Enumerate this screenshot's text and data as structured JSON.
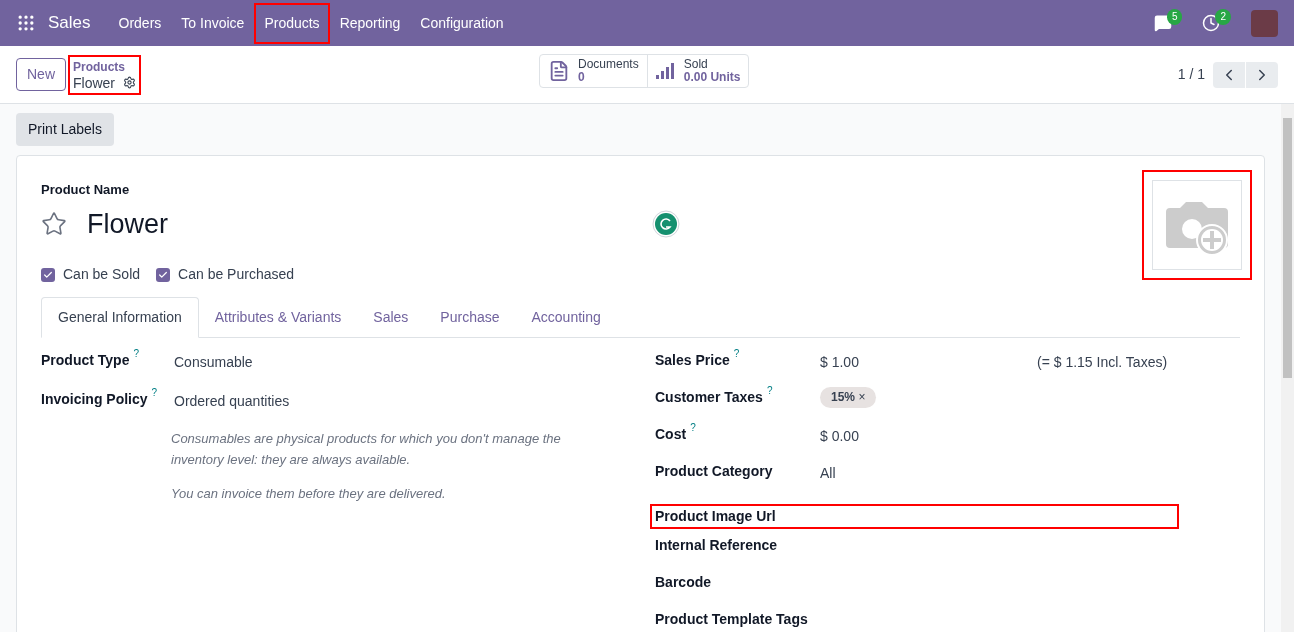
{
  "navbar": {
    "app": "Sales",
    "menu": [
      {
        "label": "Orders",
        "highlighted": false
      },
      {
        "label": "To Invoice",
        "highlighted": false
      },
      {
        "label": "Products",
        "highlighted": true
      },
      {
        "label": "Reporting",
        "highlighted": false
      },
      {
        "label": "Configuration",
        "highlighted": false
      }
    ],
    "messages_badge": "5",
    "activities_badge": "2"
  },
  "control_bar": {
    "new_button": "New",
    "breadcrumb": {
      "parent": "Products",
      "current": "Flower",
      "highlighted": true
    },
    "smart_buttons": [
      {
        "kind": "documents",
        "label": "Documents",
        "value": "0"
      },
      {
        "kind": "sold",
        "label": "Sold",
        "value": "0.00 Units"
      }
    ],
    "pager": "1 / 1"
  },
  "action_button": "Print Labels",
  "form": {
    "name_label": "Product Name",
    "name": "Flower",
    "favorite": false,
    "image_highlighted": true,
    "options": [
      {
        "label": "Can be Sold",
        "checked": true
      },
      {
        "label": "Can be Purchased",
        "checked": true
      }
    ],
    "tabs": [
      {
        "label": "General Information",
        "selected": true
      },
      {
        "label": "Attributes & Variants",
        "selected": false
      },
      {
        "label": "Sales",
        "selected": false
      },
      {
        "label": "Purchase",
        "selected": false
      },
      {
        "label": "Accounting",
        "selected": false
      }
    ],
    "left_fields": [
      {
        "label": "Product Type",
        "help": "?",
        "value": "Consumable"
      },
      {
        "label": "Invoicing Policy",
        "help": "?",
        "value": "Ordered quantities"
      }
    ],
    "notes": [
      "Consumables are physical products for which you don't manage the inventory level: they are always available.",
      "You can invoice them before they are delivered."
    ],
    "right_fields": [
      {
        "kind": "text",
        "label": "Sales Price",
        "help": "?",
        "value": "$ 1.00",
        "note": "(= $ 1.15 Incl. Taxes)",
        "highlighted": false
      },
      {
        "kind": "tag",
        "label": "Customer Taxes",
        "help": "?",
        "value": "15%",
        "remove": "×",
        "highlighted": false
      },
      {
        "kind": "text",
        "label": "Cost",
        "help": "?",
        "value": "$ 0.00",
        "highlighted": false
      },
      {
        "kind": "text",
        "label": "Product Category",
        "value": "All",
        "highlighted": false
      },
      {
        "kind": "empty",
        "label": "Product Image Url",
        "highlighted": true
      },
      {
        "kind": "empty",
        "label": "Internal Reference",
        "highlighted": false
      },
      {
        "kind": "empty",
        "label": "Barcode",
        "highlighted": false
      },
      {
        "kind": "empty",
        "label": "Product Template Tags",
        "highlighted": false
      }
    ]
  }
}
